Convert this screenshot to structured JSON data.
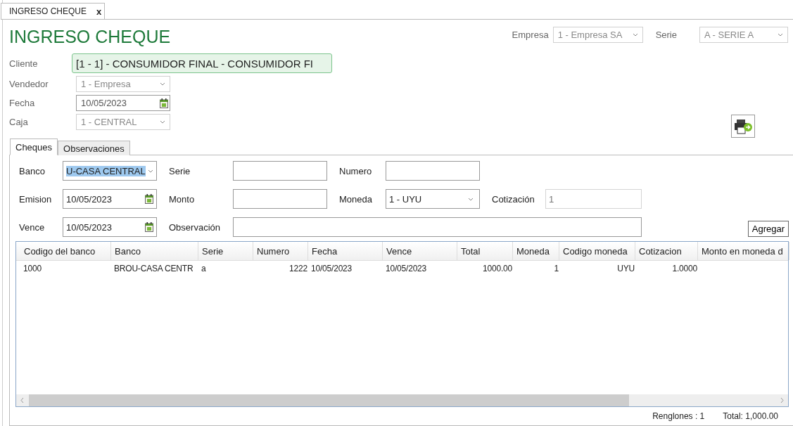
{
  "doc_tab": {
    "label": "INGRESO CHEQUE",
    "close": "x",
    "selected": true
  },
  "title": "INGRESO CHEQUE",
  "empresa": {
    "label": "Empresa",
    "value": "1 - Empresa SA"
  },
  "serie": {
    "label": "Serie",
    "value": "A - SERIE A"
  },
  "header_fields": [
    {
      "kind": "client",
      "label": "Cliente",
      "value": "[1 - 1] - CONSUMIDOR FINAL - CONSUMIDOR FI"
    },
    {
      "kind": "combo",
      "label": "Vendedor",
      "value": "1 - Empresa"
    },
    {
      "kind": "date",
      "label": "Fecha",
      "value": "10/05/2023"
    },
    {
      "kind": "combo",
      "label": "Caja",
      "value": "1 - CENTRAL"
    }
  ],
  "tabs": [
    {
      "label": "Cheques",
      "selected": true
    },
    {
      "label": "Observaciones",
      "selected": false
    }
  ],
  "cheque_form": {
    "banco": {
      "label": "Banco",
      "value": "U-CASA CENTRAL",
      "highlighted": true
    },
    "serie": {
      "label": "Serie"
    },
    "numero": {
      "label": "Numero"
    },
    "emision": {
      "label": "Emision",
      "value": "10/05/2023"
    },
    "monto": {
      "label": "Monto"
    },
    "moneda": {
      "label": "Moneda",
      "value": "1 - UYU"
    },
    "cotizacion": {
      "label": "Cotización",
      "value": "1",
      "disabled": true
    },
    "vence": {
      "label": "Vence",
      "value": "10/05/2023"
    },
    "observacion": {
      "label": "Observación"
    },
    "add_button": "Agregar"
  },
  "table": {
    "columns": [
      "Codigo del banco",
      "Banco",
      "Serie",
      "Numero",
      "Fecha",
      "Vence",
      "Total",
      "Moneda",
      "Codigo moneda",
      "Cotizacion",
      "Monto en moneda d"
    ],
    "rows": [
      [
        "1000",
        "BROU-CASA CENTR",
        "a",
        "1222",
        "10/05/2023",
        "10/05/2023",
        "1000.00",
        "1",
        "UYU",
        "1.0000"
      ]
    ]
  },
  "footer": {
    "renglones": "Renglones : 1",
    "total": "Total: 1,000.00"
  }
}
